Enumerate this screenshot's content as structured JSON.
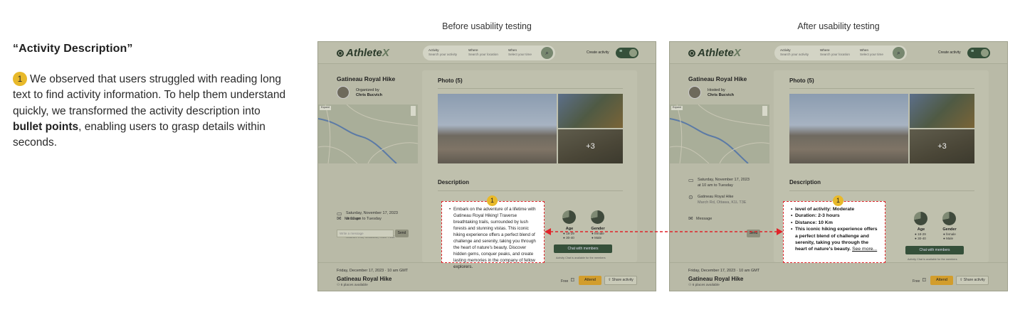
{
  "intro": {
    "title": "“Activity Description”",
    "badge": "1",
    "text_before": "We observed that users struggled with reading long text to find activity information. To help them understand quickly, we transformed the activity description into ",
    "text_bold": "bullet points",
    "text_after": ", enabling users to grasp details within seconds."
  },
  "captions": {
    "before": "Before usability testing",
    "after": "After usability testing"
  },
  "app": {
    "logo_main": "Athlete",
    "logo_accent": "X",
    "search": {
      "activity_label": "Activity",
      "activity_sub": "Search your activity",
      "where_label": "Where",
      "where_sub": "Search your location",
      "when_label": "When",
      "when_sub": "Select your time"
    },
    "create_activity": "Create activity",
    "sidebar": {
      "title": "Gatineau Royal Hike",
      "organized_by_before": "Organized by",
      "organized_by_after": "Hosted by",
      "organizer": "Chris Bucvich",
      "map_expand": "Expand",
      "date_line1": "Saturday, November 17, 2023",
      "date_line2": "at 10 am to Tuesday",
      "location_line1": "Gatineau Royal Hike",
      "location_line2": "March Rd, Ottawa, K1L T3E",
      "message_label": "Message",
      "message_placeholder": "Write a message",
      "send": "Send"
    },
    "main": {
      "photo_heading": "Photo (5)",
      "more_photos": "+3",
      "description_heading": "Description",
      "age_label": "Age",
      "age_legend_1": "18-29",
      "age_legend_2": "30-40",
      "gender_label": "Gender",
      "gender_legend_1": "female",
      "gender_legend_2": "Male",
      "chat_button": "Chat with members",
      "chat_note": "Activity Chat is available for the members"
    },
    "footer": {
      "date": "Friday, December 17, 2023 · 10 am GMT",
      "title": "Gatineau Royal Hike",
      "places": "6 places available",
      "free": "Free",
      "attend": "Attend",
      "share": "Share activity"
    }
  },
  "before_description": "Embark on the adventure of a lifetime with Gatineau Royal Hiking! Traverse breathtaking trails, surrounded by lush forests and stunning vistas. This iconic hiking experience offers a perfect blend of challenge and serenity, taking you through the heart of nature's beauty. Discover hidden gems, conquer peaks, and create lasting memories in the company of fellow explorers.",
  "after_description": {
    "items": [
      "level of activity: Moderate",
      "Duration: 2-3 hours",
      "Distance: 10 Km",
      "This iconic hiking experience offers a perfect blend of challenge and serenity, taking you through the heart of nature's beauty. "
    ],
    "see_more": "See more..."
  },
  "highlight_number": "1",
  "colors": {
    "accent_yellow": "#e8b92a",
    "highlight_red": "#e0242a",
    "brand_green": "#35503a"
  }
}
